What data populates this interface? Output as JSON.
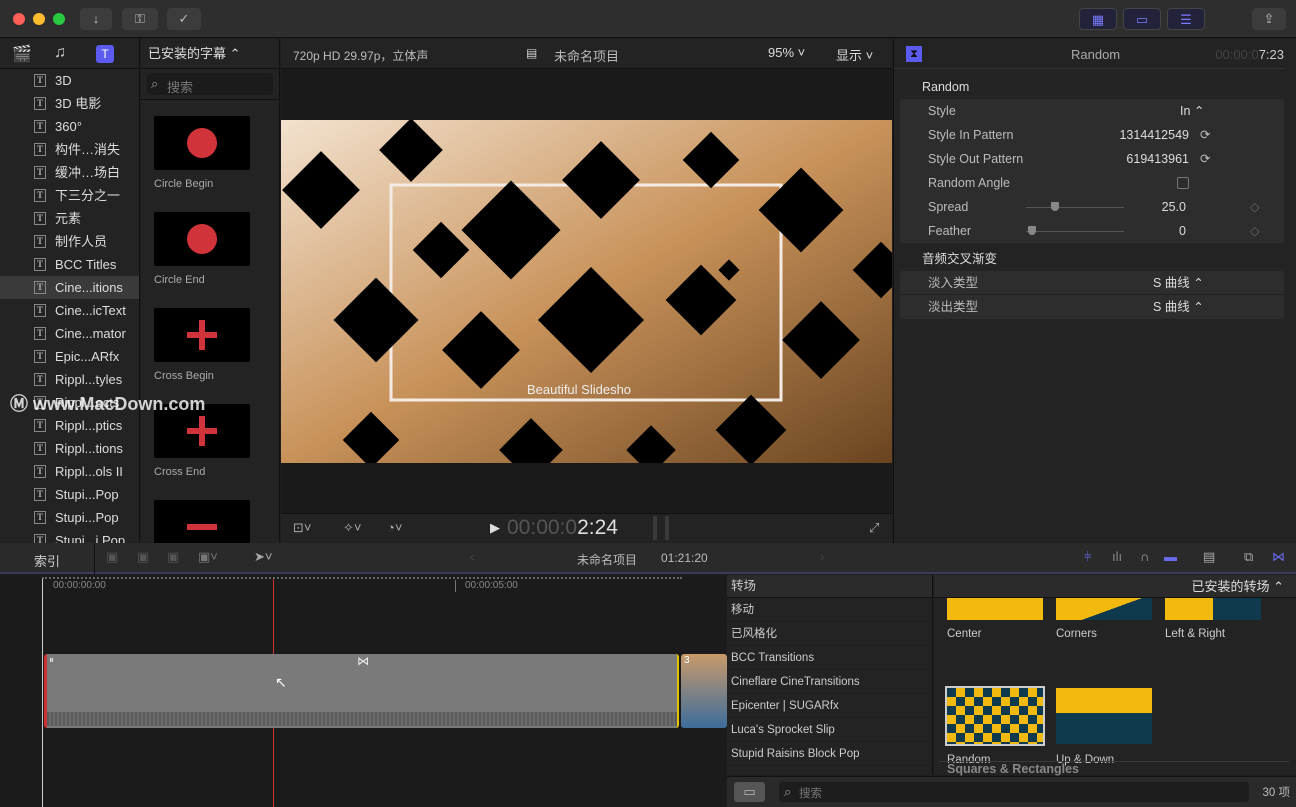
{
  "titlebar": {
    "buttons": [
      "download-icon",
      "key-icon",
      "checkmark-icon"
    ],
    "right_buttons": [
      "browser-layout-icon",
      "timeline-layout-icon",
      "inspector-layout-icon",
      "share-icon"
    ]
  },
  "sidebar": {
    "tabs": [
      "libraries",
      "photos-audio",
      "titles-generators"
    ],
    "items": [
      {
        "label": "3D"
      },
      {
        "label": "3D 电影"
      },
      {
        "label": "360°"
      },
      {
        "label": "构件…消失"
      },
      {
        "label": "缓冲…场白"
      },
      {
        "label": "下三分之一"
      },
      {
        "label": "元素"
      },
      {
        "label": "制作人员"
      },
      {
        "label": "BCC Titles"
      },
      {
        "label": "Cine...itions",
        "selected": true
      },
      {
        "label": "Cine...icText"
      },
      {
        "label": "Cine...mator"
      },
      {
        "label": "Epic...ARfx"
      },
      {
        "label": "Rippl...tyles"
      },
      {
        "label": "Rippl...ects"
      },
      {
        "label": "Rippl...ptics"
      },
      {
        "label": "Rippl...tions"
      },
      {
        "label": "Rippl...ols II"
      },
      {
        "label": "Stupi...Pop"
      },
      {
        "label": "Stupi...Pop"
      },
      {
        "label": "Stupi...i Pop"
      }
    ]
  },
  "browser": {
    "title": "已安装的字幕",
    "search_placeholder": "搜索",
    "items": [
      {
        "label": "Circle Begin",
        "shape": "circle"
      },
      {
        "label": "Circle End",
        "shape": "circle"
      },
      {
        "label": "Cross Begin",
        "shape": "cross"
      },
      {
        "label": "Cross End",
        "shape": "cross"
      },
      {
        "label": "",
        "shape": "minus"
      }
    ],
    "accent": "#d0343a"
  },
  "viewer": {
    "format": "720p HD 29.97p，立体声",
    "project": "未命名项目",
    "zoom": "95%",
    "display": "显示",
    "overlay_text": "Beautiful Slidesho",
    "timecode_dim": "00:00:0",
    "timecode": "2:24"
  },
  "inspector": {
    "title": "Random",
    "timecode_dim": "00:00:0",
    "timecode": "7:23",
    "section1": "Random",
    "style_label": "Style",
    "style_value": "In",
    "in_pattern_label": "Style In Pattern",
    "in_pattern_value": "1314412549",
    "out_pattern_label": "Style Out Pattern",
    "out_pattern_value": "619413961",
    "random_angle_label": "Random Angle",
    "random_angle_checked": false,
    "spread_label": "Spread",
    "spread_value": "25.0",
    "feather_label": "Feather",
    "feather_value": "0",
    "section2": "音频交叉渐变",
    "fade_in_label": "淡入类型",
    "fade_in_value": "S 曲线",
    "fade_out_label": "淡出类型",
    "fade_out_value": "S 曲线"
  },
  "timeline_toolbar": {
    "index": "索引",
    "project": "未命名项目",
    "duration": "01:21:20"
  },
  "timeline": {
    "ruler": [
      "00:00:00:00",
      "00:00:05:00"
    ],
    "clip_number": "3"
  },
  "transitions": {
    "header": "转场",
    "filter": "已安装的转场",
    "categories": [
      "移动",
      "已风格化",
      "BCC Transitions",
      "Cineflare CineTransitions",
      "Epicenter | SUGARfx",
      "Luca's Sprocket Slip",
      "Stupid Raisins Block Pop"
    ],
    "items": [
      {
        "label": "Center"
      },
      {
        "label": "Corners"
      },
      {
        "label": "Left & Right"
      },
      {
        "label": "Random",
        "selected": true
      },
      {
        "label": "Up & Down"
      }
    ],
    "section": "Squares & Rectangles",
    "search_placeholder": "搜索",
    "count": "30 项",
    "colors": {
      "yellow": "#f2b90f",
      "navy": "#0f3a4e"
    }
  },
  "watermark": "www.MacDown.com"
}
